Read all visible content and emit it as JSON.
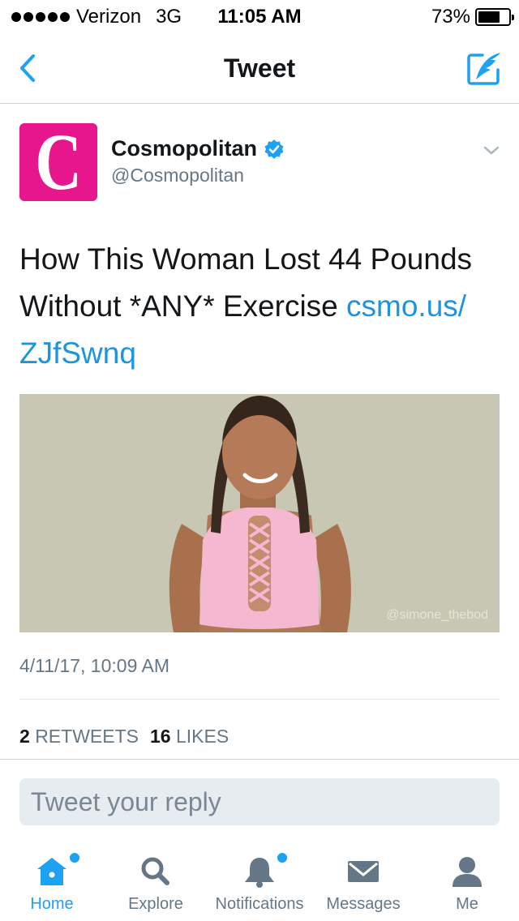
{
  "status_bar": {
    "carrier": "Verizon",
    "network": "3G",
    "time": "11:05 AM",
    "battery_percent": "73%",
    "battery_level": 0.73
  },
  "nav": {
    "title": "Tweet",
    "back_icon": "chevron-left-icon",
    "compose_icon": "compose-quill-icon"
  },
  "tweet": {
    "author_name": "Cosmopolitan",
    "author_handle": "@Cosmopolitan",
    "avatar_letter": "C",
    "verified": true,
    "text": "How This Woman Lost 44 Pounds Without *ANY* Exercise ",
    "link_text": "csmo.us/ ZJfSwnq",
    "media_watermark": "@simone_thebod",
    "timestamp": "4/11/17, 10:09 AM",
    "retweets_count": "2",
    "retweets_label": "RETWEETS",
    "likes_count": "16",
    "likes_label": "LIKES"
  },
  "reply": {
    "placeholder": "Tweet your reply"
  },
  "tab_bar": {
    "tabs": [
      {
        "label": "Home",
        "icon": "home-icon",
        "active": true,
        "badge": true
      },
      {
        "label": "Explore",
        "icon": "search-icon",
        "active": false,
        "badge": false
      },
      {
        "label": "Notifications",
        "icon": "bell-icon",
        "active": false,
        "badge": true
      },
      {
        "label": "Messages",
        "icon": "envelope-icon",
        "active": false,
        "badge": false
      },
      {
        "label": "Me",
        "icon": "person-icon",
        "active": false,
        "badge": false
      }
    ]
  },
  "colors": {
    "accent": "#1da1f2",
    "link": "#1b95e0",
    "brand_avatar": "#e8168c",
    "secondary_text": "#657786",
    "reply_bg": "#e6ecf0"
  }
}
